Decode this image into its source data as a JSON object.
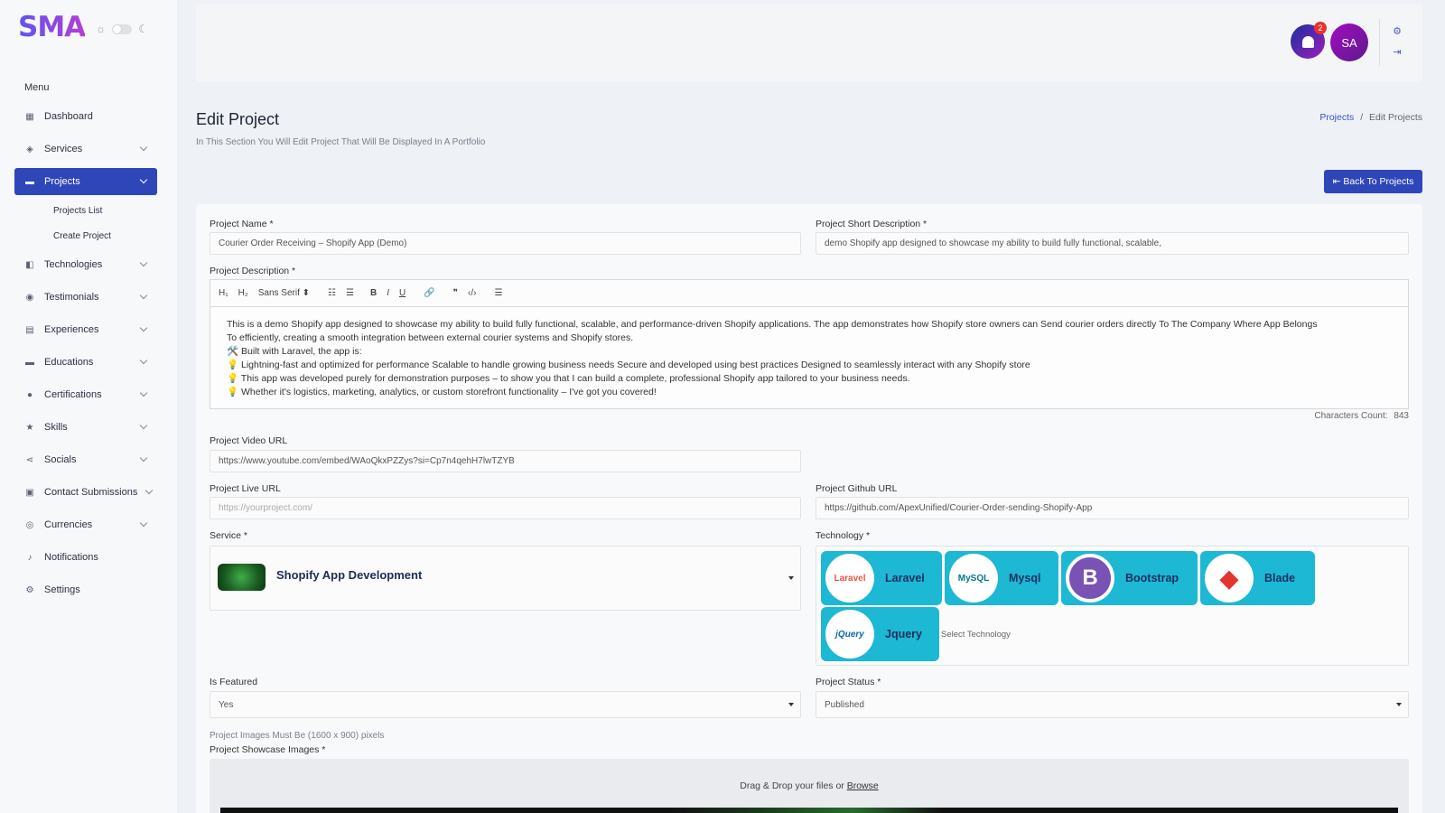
{
  "brand": {
    "logo": "SMA"
  },
  "sidebar": {
    "menu_heading": "Menu",
    "items": [
      {
        "label": "Dashboard",
        "icon": "grid-icon",
        "expandable": false,
        "active": false
      },
      {
        "label": "Services",
        "icon": "tag-icon",
        "expandable": true,
        "active": false
      },
      {
        "label": "Projects",
        "icon": "folder-icon",
        "expandable": true,
        "active": true
      },
      {
        "label": "Technologies",
        "icon": "layers-icon",
        "expandable": true,
        "active": false
      },
      {
        "label": "Testimonials",
        "icon": "chat-icon",
        "expandable": true,
        "active": false
      },
      {
        "label": "Experiences",
        "icon": "id-card-icon",
        "expandable": true,
        "active": false
      },
      {
        "label": "Educations",
        "icon": "book-icon",
        "expandable": true,
        "active": false
      },
      {
        "label": "Certifications",
        "icon": "badge-icon",
        "expandable": true,
        "active": false
      },
      {
        "label": "Skills",
        "icon": "star-icon",
        "expandable": true,
        "active": false
      },
      {
        "label": "Socials",
        "icon": "share-icon",
        "expandable": true,
        "active": false
      },
      {
        "label": "Contact Submissions",
        "icon": "inbox-icon",
        "expandable": true,
        "active": false
      },
      {
        "label": "Currencies",
        "icon": "coins-icon",
        "expandable": true,
        "active": false
      },
      {
        "label": "Notifications",
        "icon": "bell-icon",
        "expandable": false,
        "active": false
      },
      {
        "label": "Settings",
        "icon": "gear-icon",
        "expandable": false,
        "active": false
      }
    ],
    "projects_submenu": [
      "Projects List",
      "Create Project"
    ]
  },
  "topbar": {
    "notification_count": "2",
    "avatar_initials": "SA"
  },
  "header": {
    "title": "Edit Project",
    "subtitle": "In This Section You Will Edit Project That Will Be Displayed In A Portfolio",
    "breadcrumb_link": "Projects",
    "breadcrumb_sep": "/",
    "breadcrumb_current": "Edit Projects",
    "back_button": "Back To Projects"
  },
  "form": {
    "project_name_label": "Project Name *",
    "project_name_value": "Courier Order Receiving – Shopify App (Demo)",
    "short_desc_label": "Project Short Description *",
    "short_desc_value": "demo Shopify app designed to showcase my ability to build fully functional, scalable,",
    "description_label": "Project Description *",
    "toolbar": {
      "h1": "H₁",
      "h2": "H₂",
      "font": "Sans Serif ⬍",
      "ol": "☷",
      "ul": "☰",
      "bold": "B",
      "italic": "I",
      "underline": "U",
      "link": "🔗",
      "quote": "❞",
      "code": "‹/›",
      "align": "☰"
    },
    "description_lines": [
      "This is a demo Shopify app designed to showcase my ability to build fully functional, scalable, and performance-driven Shopify applications. The app demonstrates how Shopify store owners can Send courier orders directly To The Company Where App Belongs",
      "To efficiently, creating a smooth integration between external courier systems and Shopify stores.",
      "🛠️ Built with Laravel, the app is:",
      "💡 Lightning-fast and optimized for performance Scalable to handle growing business needs Secure and developed using best practices Designed to seamlessly interact with any Shopify store",
      "💡 This app was developed purely for demonstration purposes – to show you that I can build a complete, professional Shopify app tailored to your business needs.",
      "💡 Whether it's logistics, marketing, analytics, or custom storefront functionality – I've got you covered!"
    ],
    "char_count_label": "Characters Count:",
    "char_count_value": "843",
    "video_url_label": "Project Video URL",
    "video_url_value": "https://www.youtube.com/embed/WAoQkxPZZys?si=Cp7n4qehH7lwTZYB",
    "live_url_label": "Project Live URL",
    "live_url_placeholder": "https://yourproject.com/",
    "github_url_label": "Project Github URL",
    "github_url_value": "https://github.com/ApexUnified/Courier-Order-sending-Shopify-App",
    "service_label": "Service *",
    "service_value": "Shopify App Development",
    "technology_label": "Technology *",
    "technologies": [
      {
        "name": "Laravel",
        "logo_text": "Laravel",
        "logo_color": "#f05340"
      },
      {
        "name": "Mysql",
        "logo_text": "MySQL",
        "logo_color": "#00758f"
      },
      {
        "name": "Bootstrap",
        "logo_text": "B",
        "logo_color": "#7952b3"
      },
      {
        "name": "Blade",
        "logo_text": "◆",
        "logo_color": "#e3342f"
      },
      {
        "name": "Jquery",
        "logo_text": "jQuery",
        "logo_color": "#0868ac"
      }
    ],
    "technology_hint": "Select Technology",
    "featured_label": "Is Featured",
    "featured_value": "Yes",
    "status_label": "Project Status *",
    "status_value": "Published",
    "images_hint": "Project Images Must Be (1600 x 900) pixels",
    "images_label": "Project Showcase Images *",
    "drop_text": "Drag & Drop your files or",
    "drop_browse": "Browse"
  },
  "colors": {
    "primary": "#2f46b8",
    "chip": "#1db8d3",
    "badge": "#e8322d"
  }
}
